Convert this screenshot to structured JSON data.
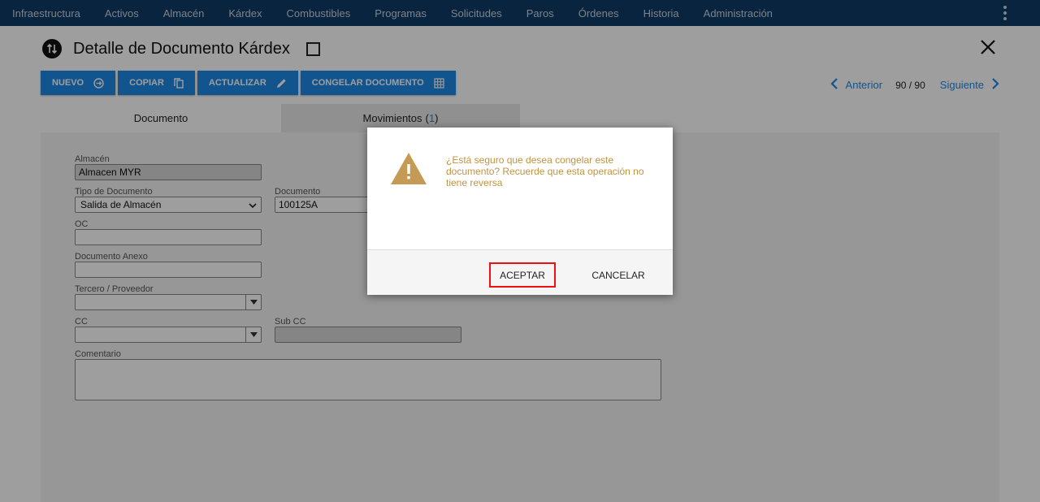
{
  "nav": {
    "items": [
      "Infraestructura",
      "Activos",
      "Almacén",
      "Kárdex",
      "Combustibles",
      "Programas",
      "Solicitudes",
      "Paros",
      "Órdenes",
      "Historia",
      "Administración"
    ],
    "menu_icon": "kebab-menu-icon"
  },
  "header": {
    "title": "Detalle de Documento Kárdex",
    "icon": "up-down-arrows-icon"
  },
  "toolbar": {
    "new_label": "NUEVO",
    "copy_label": "COPIAR",
    "update_label": "ACTUALIZAR",
    "freeze_label": "CONGELAR DOCUMENTO"
  },
  "pager": {
    "prev_label": "Anterior",
    "count": "90 / 90",
    "next_label": "Siguiente"
  },
  "tabs": {
    "documento": "Documento",
    "movimientos": "Movimientos",
    "movimientos_count": "1"
  },
  "form": {
    "almacen_label": "Almacén",
    "almacen_value": "Almacen MYR",
    "tipo_label": "Tipo de Documento",
    "tipo_value": "Salida de Almacén",
    "documento_label": "Documento",
    "documento_value": "100125A",
    "oc_label": "OC",
    "oc_value": "",
    "anexo_label": "Documento Anexo",
    "anexo_value": "",
    "tercero_label": "Tercero / Proveedor",
    "tercero_value": "",
    "cc_label": "CC",
    "cc_value": "",
    "subcc_label": "Sub CC",
    "subcc_value": "",
    "comentario_label": "Comentario",
    "comentario_value": ""
  },
  "dialog": {
    "message": "¿Está seguro que desea congelar este documento? Recuerde que esta operación no tiene reversa",
    "accept_label": "ACEPTAR",
    "cancel_label": "CANCELAR",
    "message_color": "#c0933f",
    "warning_color": "#c49a55"
  },
  "colors": {
    "nav_bg": "#0d3a66",
    "accent": "#1e88e5",
    "highlight_border": "#e11111"
  }
}
